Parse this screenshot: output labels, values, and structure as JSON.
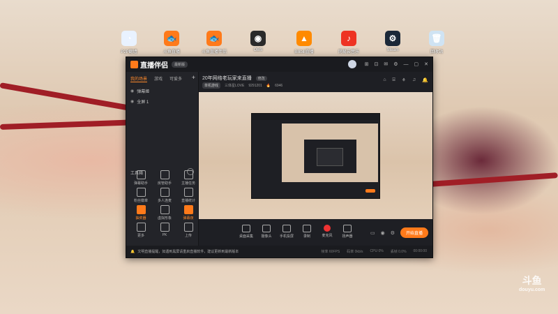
{
  "desktop_icons": [
    {
      "label": "P2P翻墙",
      "color": "#e9f2ff",
      "glyph": "◔"
    },
    {
      "label": "斗鱼直播",
      "color": "#ff7a1a",
      "glyph": "🐟"
    },
    {
      "label": "斗鱼直播伴侣",
      "color": "#ff7a1a",
      "glyph": "🐟"
    },
    {
      "label": "OBS",
      "color": "#2a2a2a",
      "glyph": "◉"
    },
    {
      "label": "Bilibili直播",
      "color": "#ff8a00",
      "glyph": "▲"
    },
    {
      "label": "网易云音乐",
      "color": "#e32",
      "glyph": "♪"
    },
    {
      "label": "Steam",
      "color": "#1b2838",
      "glyph": "⚙"
    },
    {
      "label": "回收站",
      "color": "#cfe3f3",
      "glyph": "🗑"
    }
  ],
  "app": {
    "title": "直播伴侣",
    "version": "最新版",
    "window_controls": [
      "⊞",
      "⊡",
      "✉",
      "⚙",
      "—",
      "▢",
      "✕"
    ]
  },
  "left_panel": {
    "tabs": [
      "我的场景",
      "游戏",
      "可爱多"
    ],
    "add_label": "+",
    "sources": [
      {
        "eye": "◉",
        "name": "弹幕姬"
      },
      {
        "eye": "◉",
        "name": "全屏 1"
      }
    ],
    "tools_title": "工具箱",
    "tools_more": "···",
    "tools": [
      {
        "label": "弹幕助手",
        "highlight": false
      },
      {
        "label": "房管助手",
        "highlight": false
      },
      {
        "label": "主播任务",
        "highlight": false
      },
      {
        "label": "粉丝徽章",
        "highlight": false
      },
      {
        "label": "多人连麦",
        "highlight": false
      },
      {
        "label": "直播统计",
        "highlight": false
      },
      {
        "label": "抽奖器",
        "highlight": true
      },
      {
        "label": "虚拟形象",
        "highlight": false
      },
      {
        "label": "弹幕夜",
        "highlight": true
      },
      {
        "label": "更多",
        "highlight": false
      },
      {
        "label": "PK",
        "highlight": false
      },
      {
        "label": "上传",
        "highlight": false
      }
    ]
  },
  "main": {
    "room_title": "20年网络老玩家来直播",
    "room_badge": "修改",
    "category": "单机游戏",
    "anchor": "三体星LOVE",
    "room_id": "9291201",
    "hot": "6946",
    "header_icons": [
      "⌂",
      "⌸",
      "⚘",
      "♫",
      "🔔"
    ]
  },
  "controls": [
    {
      "label": "桌面采集",
      "red": false
    },
    {
      "label": "摄像头",
      "red": false
    },
    {
      "label": "手机投屏",
      "red": false
    },
    {
      "label": "录制",
      "red": false
    },
    {
      "label": "麦克风",
      "red": true
    },
    {
      "label": "扬声器",
      "red": false
    }
  ],
  "go_live_label": "开始直播",
  "notice": {
    "bell": "🔔",
    "text": "文明直播提醒，如遇到黑屏请重启直播软件，建议更新到最新版本"
  },
  "status": [
    "帧率 60FPS",
    "码率 0kb/s",
    "CPU 0%",
    "丢帧 0.0%",
    "00:00:00"
  ],
  "watermark": {
    "top": "斗鱼",
    "bottom": "douyu.com"
  }
}
